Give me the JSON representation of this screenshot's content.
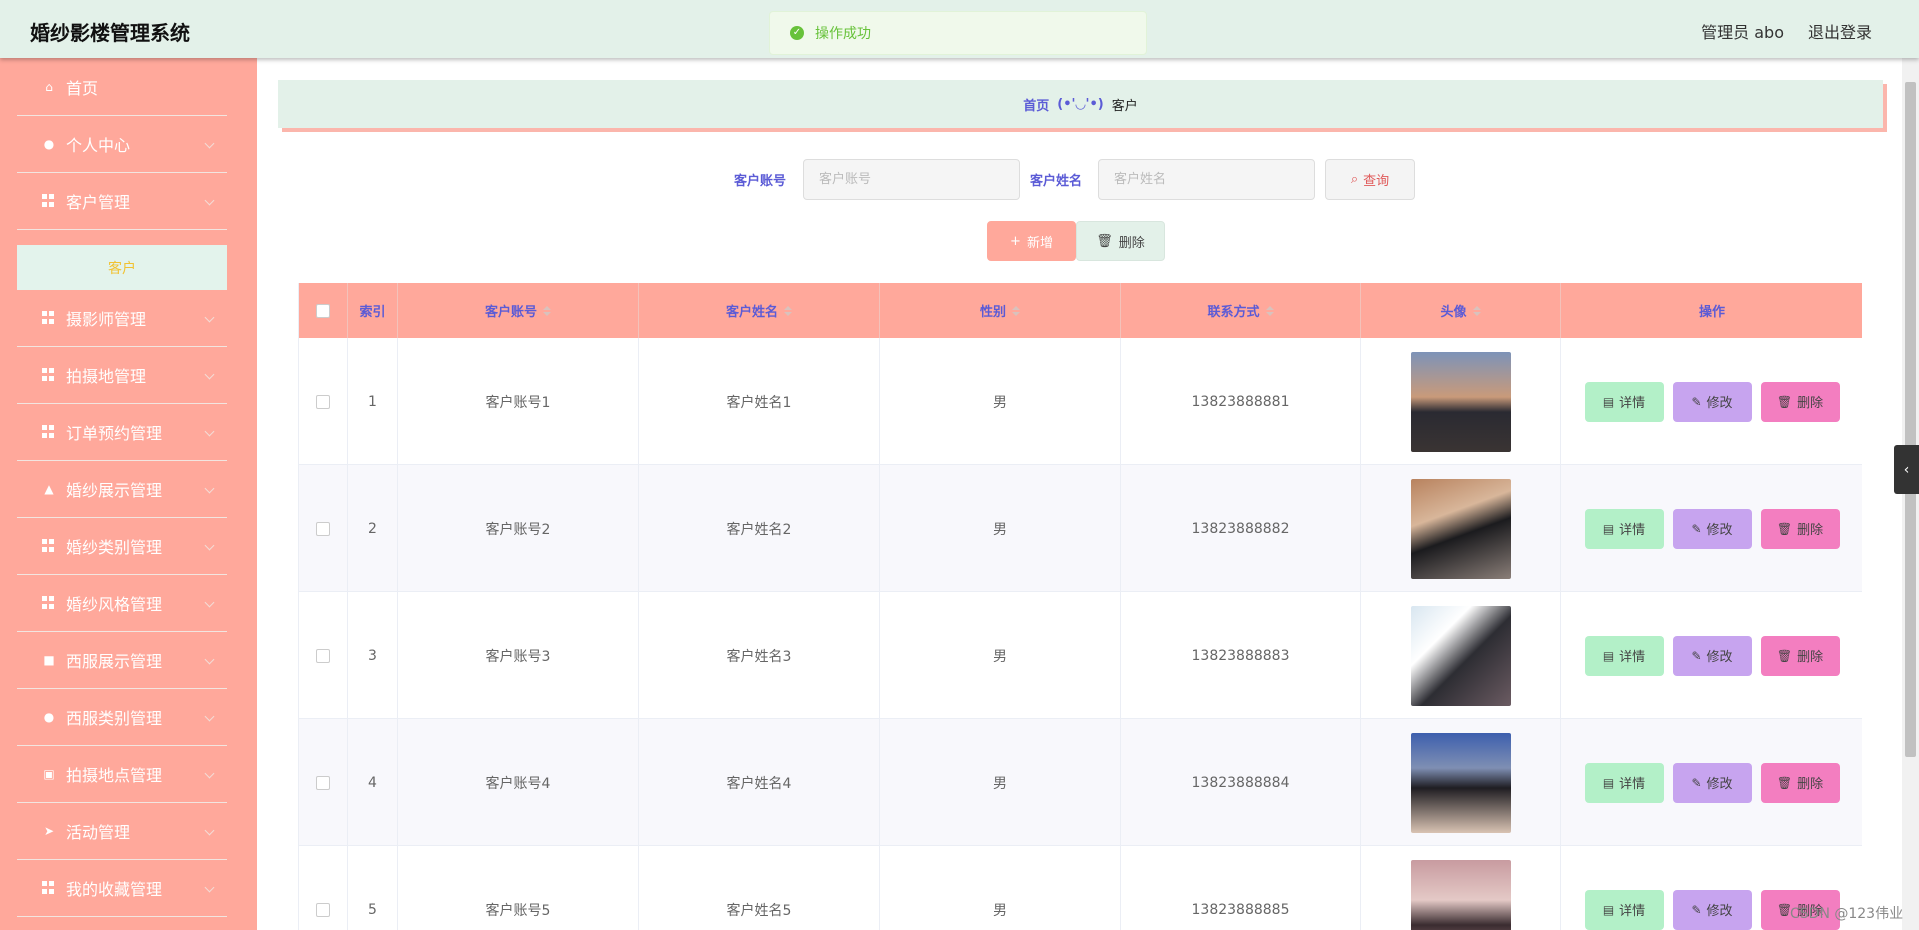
{
  "header": {
    "title": "婚纱影楼管理系统",
    "admin": "管理员 abo",
    "logout": "退出登录"
  },
  "toast": {
    "message": "操作成功"
  },
  "sidebar": {
    "items": [
      {
        "label": "首页",
        "icon": "home-icon"
      },
      {
        "label": "个人中心",
        "icon": "user-icon"
      },
      {
        "label": "客户管理",
        "icon": "grid-icon"
      },
      {
        "label": "摄影师管理",
        "icon": "grid-icon"
      },
      {
        "label": "拍摄地管理",
        "icon": "grid-icon"
      },
      {
        "label": "订单预约管理",
        "icon": "grid-icon"
      },
      {
        "label": "婚纱展示管理",
        "icon": "thumbs-up-icon"
      },
      {
        "label": "婚纱类别管理",
        "icon": "grid-icon"
      },
      {
        "label": "婚纱风格管理",
        "icon": "grid-icon"
      },
      {
        "label": "西服展示管理",
        "icon": "briefcase-icon"
      },
      {
        "label": "西服类别管理",
        "icon": "user-icon"
      },
      {
        "label": "拍摄地点管理",
        "icon": "clipboard-icon"
      },
      {
        "label": "活动管理",
        "icon": "send-icon"
      },
      {
        "label": "我的收藏管理",
        "icon": "grid-icon"
      }
    ],
    "active_sub": "客户"
  },
  "breadcrumb": {
    "home": "首页",
    "sep": "(•'◡'•)",
    "current": "客户"
  },
  "search": {
    "account_label": "客户账号",
    "account_placeholder": "客户账号",
    "name_label": "客户姓名",
    "name_placeholder": "客户姓名",
    "query_button": "查询"
  },
  "actions": {
    "add": "新增",
    "delete": "删除"
  },
  "table": {
    "columns": [
      "索引",
      "客户账号",
      "客户姓名",
      "性别",
      "联系方式",
      "头像",
      "操作"
    ],
    "rows": [
      {
        "index": "1",
        "account": "客户账号1",
        "name": "客户姓名1",
        "gender": "男",
        "phone": "13823888881"
      },
      {
        "index": "2",
        "account": "客户账号2",
        "name": "客户姓名2",
        "gender": "男",
        "phone": "13823888882"
      },
      {
        "index": "3",
        "account": "客户账号3",
        "name": "客户姓名3",
        "gender": "男",
        "phone": "13823888883"
      },
      {
        "index": "4",
        "account": "客户账号4",
        "name": "客户姓名4",
        "gender": "男",
        "phone": "13823888884"
      },
      {
        "index": "5",
        "account": "客户账号5",
        "name": "客户姓名5",
        "gender": "男",
        "phone": "13823888885"
      }
    ],
    "row_actions": {
      "detail": "详情",
      "edit": "修改",
      "delete": "删除"
    }
  },
  "watermark": "CSDN @123伟业",
  "colors": {
    "header_bg": "#e3f1e9",
    "sidebar_bg": "#ffa89b",
    "accent_text": "#5b5bd6",
    "success": "#67c23a"
  }
}
